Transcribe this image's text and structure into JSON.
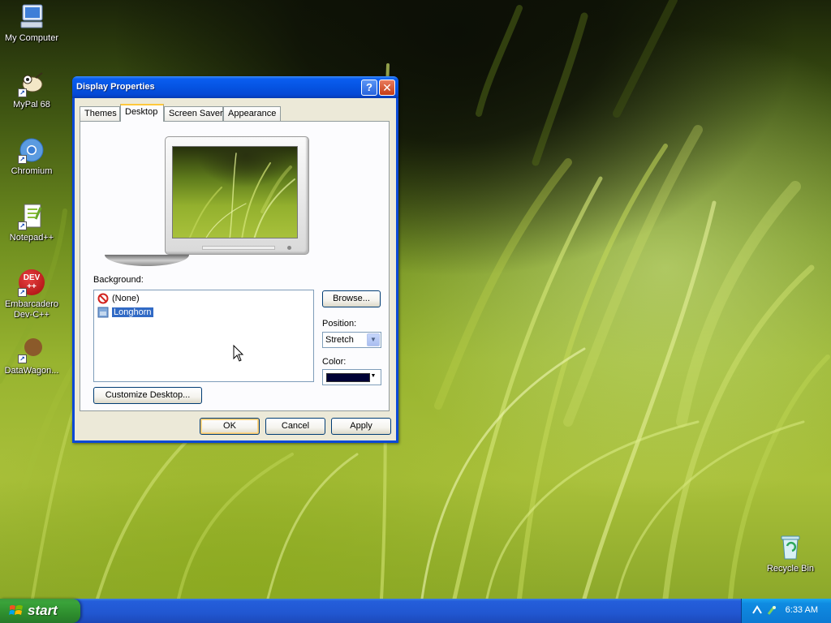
{
  "desktop": {
    "icons": [
      {
        "label": "My Computer",
        "icon": "my-computer-icon"
      },
      {
        "label": "MyPal 68",
        "icon": "mypal-icon"
      },
      {
        "label": "Chromium",
        "icon": "chromium-icon"
      },
      {
        "label": "Notepad++",
        "icon": "notepadpp-icon"
      },
      {
        "label": "Embarcadero Dev-C++",
        "icon": "devcpp-icon"
      },
      {
        "label": "DataWagon...",
        "icon": "datawagon-icon"
      },
      {
        "label": "Recycle Bin",
        "icon": "recycle-bin-icon"
      }
    ],
    "devcpp_logo_top": "DEV",
    "devcpp_logo_bottom": "++"
  },
  "window": {
    "title": "Display Properties",
    "help_glyph": "?",
    "close_glyph": "✕",
    "tabs": [
      {
        "label": "Themes",
        "active": false
      },
      {
        "label": "Desktop",
        "active": true
      },
      {
        "label": "Screen Saver",
        "active": false
      },
      {
        "label": "Appearance",
        "active": false
      }
    ],
    "background_label": "Background:",
    "background_items": [
      {
        "label": "(None)",
        "icon": "none-icon",
        "selected": false
      },
      {
        "label": "Longhorn",
        "icon": "image-file-icon",
        "selected": true
      }
    ],
    "browse_label": "Browse...",
    "position_label": "Position:",
    "position_value": "Stretch",
    "color_label": "Color:",
    "color_value": "#000236",
    "customize_label": "Customize Desktop...",
    "ok_label": "OK",
    "cancel_label": "Cancel",
    "apply_label": "Apply"
  },
  "taskbar": {
    "start_label": "start",
    "clock": "6:33 AM"
  }
}
